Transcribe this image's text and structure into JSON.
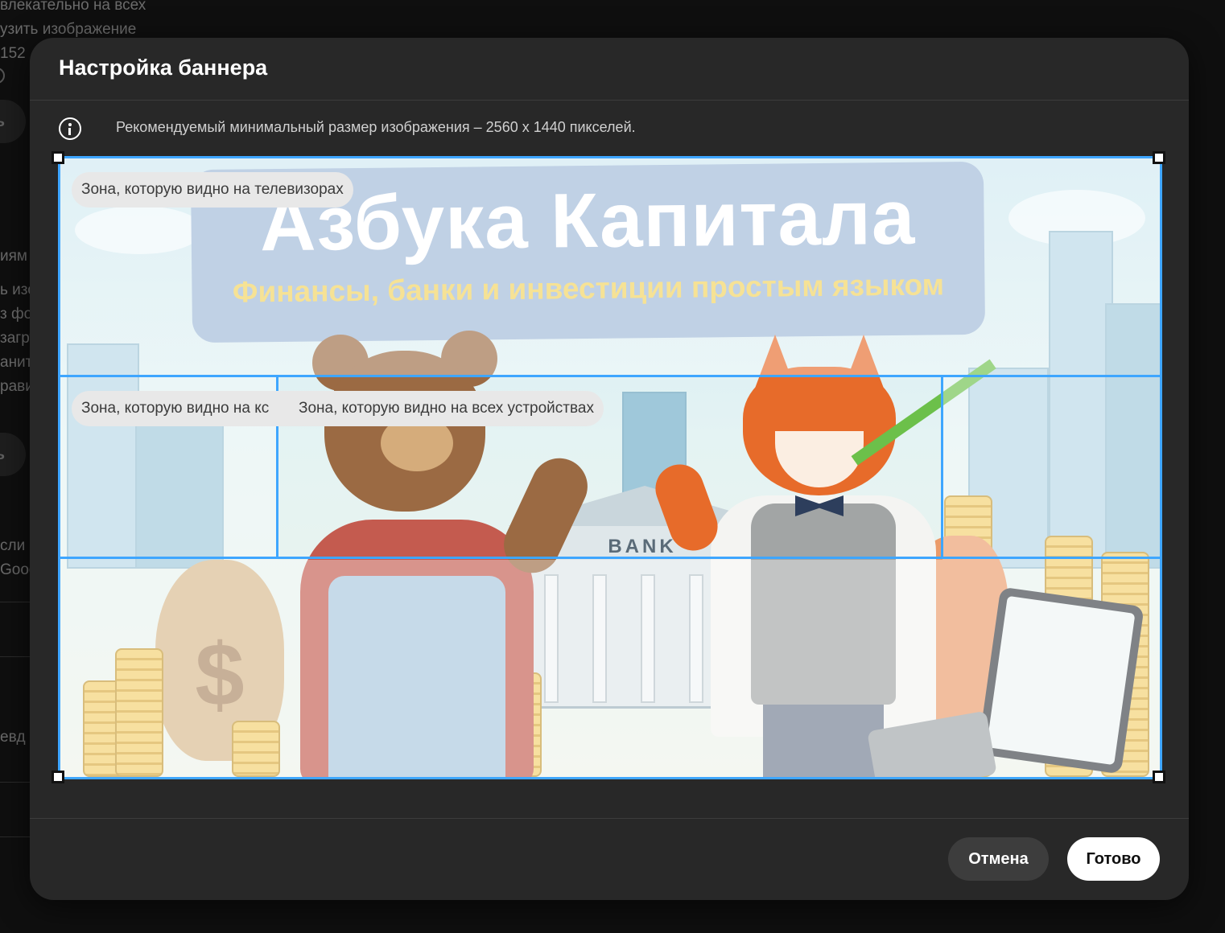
{
  "background": {
    "lines": [
      "влекательно на всех",
      "узить изображение",
      " 152",
      "иям",
      "ь изо",
      "з фор",
      "загру",
      "анит",
      "рави",
      "сли",
      "Goog",
      "евд"
    ],
    "pill_labels": [
      "ь",
      "ь"
    ]
  },
  "dialog": {
    "title": "Настройка баннера",
    "info_text": "Рекомендуемый минимальный размер изображения – 2560 x 1440 пикселей.",
    "info_icon": "info-icon"
  },
  "banner": {
    "title": "Азбука Капитала",
    "subtitle": "Финансы, банки и инвестиции простым языком",
    "bank_sign": "BANK",
    "bag_sign": "$"
  },
  "zones": {
    "tv": "Зона, которую видно на телевизорах",
    "desktop": "Зона, которую видно на кс",
    "all_devices": "Зона, которую видно на всех устройствах"
  },
  "buttons": {
    "cancel": "Отмена",
    "done": "Готово"
  },
  "colors": {
    "accent": "#3ea6ff",
    "dialog_bg": "#282828",
    "page_bg": "#0f0f0f"
  }
}
